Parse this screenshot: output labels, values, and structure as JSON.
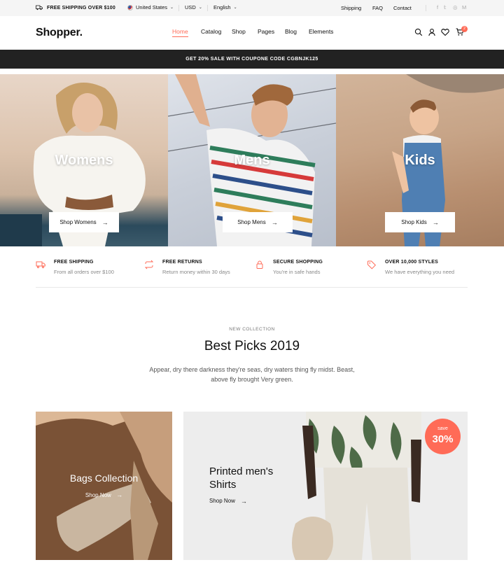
{
  "topbar": {
    "shipping_text": "FREE SHIPPING OVER $100",
    "country": "United States",
    "currency": "USD",
    "language": "English",
    "links": [
      "Shipping",
      "FAQ",
      "Contact"
    ],
    "social_icons": [
      "facebook-icon",
      "twitter-icon",
      "instagram-icon",
      "medium-icon"
    ]
  },
  "header": {
    "logo": "Shopper.",
    "nav": [
      "Home",
      "Catalog",
      "Shop",
      "Pages",
      "Blog",
      "Elements"
    ],
    "active_nav": "Home",
    "cart_count": "2",
    "accent_color": "#ff6b57"
  },
  "promo": {
    "text": "GET 20% SALE WITH COUPONE CODE CGBNJK125"
  },
  "hero": [
    {
      "title": "Womens",
      "button": "Shop Womens"
    },
    {
      "title": "Mens",
      "button": "Shop Mens"
    },
    {
      "title": "Kids",
      "button": "Shop Kids"
    }
  ],
  "features": [
    {
      "icon": "truck-icon",
      "title": "FREE SHIPPING",
      "subtitle": "From all orders over $100"
    },
    {
      "icon": "repeat-icon",
      "title": "FREE RETURNS",
      "subtitle": "Return money within 30 days"
    },
    {
      "icon": "lock-icon",
      "title": "SECURE SHOPPING",
      "subtitle": "You're in safe hands"
    },
    {
      "icon": "tag-icon",
      "title": "OVER 10,000 STYLES",
      "subtitle": "We have everything you need"
    }
  ],
  "collection": {
    "eyebrow": "NEW COLLECTION",
    "title": "Best Picks 2019",
    "description": "Appear, dry there darkness they're seas, dry waters thing fly midst. Beast, above fly brought Very green."
  },
  "cards": {
    "bags": {
      "title": "Bags Collection",
      "link": "Shop Now"
    },
    "shirts": {
      "title": "Printed men's Shirts",
      "link": "Shop Now",
      "badge_label": "save",
      "badge_value": "30%"
    }
  }
}
